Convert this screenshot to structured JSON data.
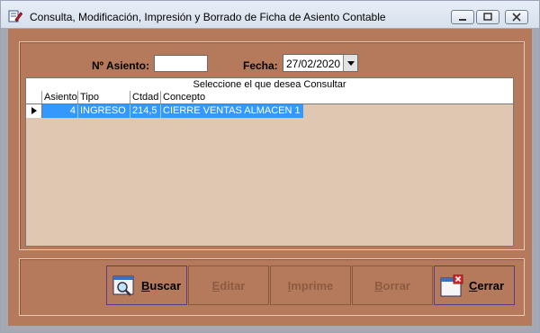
{
  "window": {
    "title": "Consulta, Modificación, Impresión y Borrado de Ficha de Asiento Contable"
  },
  "form": {
    "asiento_label": "Nº Asiento:",
    "asiento_value": "",
    "fecha_label": "Fecha:",
    "fecha_value": "27/02/2020"
  },
  "grid": {
    "caption": "Seleccione el que desea Consultar",
    "columns": [
      "Asiento",
      "Tipo",
      "Ctdad",
      "Concepto"
    ],
    "rows": [
      {
        "asiento": "4",
        "tipo": "INGRESO",
        "ctdad": "214,5",
        "concepto": "CIERRE VENTAS ALMACEN 1"
      }
    ]
  },
  "buttons": {
    "buscar": "Buscar",
    "editar": "Editar",
    "imprime": "Imprime",
    "borrar": "Borrar",
    "cerrar": "Cerrar"
  },
  "colors": {
    "background": "#b57a5b",
    "selection": "#3399ff"
  }
}
